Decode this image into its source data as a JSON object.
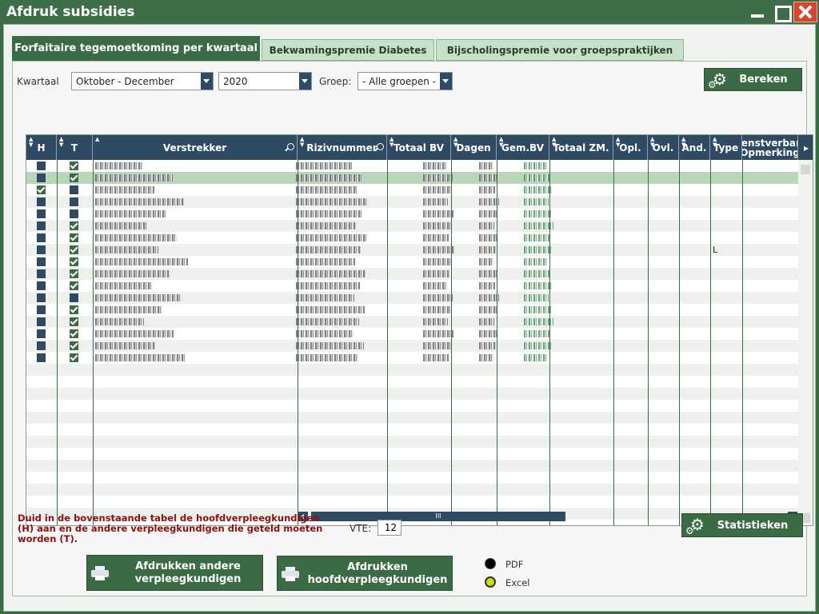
{
  "window": {
    "title": "Afdruk subsidies"
  },
  "tabs": [
    {
      "label": "Forfaitaire tegemoetkoming per kwartaal",
      "active": true
    },
    {
      "label": "Bekwamingspremie Diabetes",
      "active": false
    },
    {
      "label": "Bijscholingspremie voor groepspraktijken",
      "active": false
    }
  ],
  "filters": {
    "kwartaal_label": "Kwartaal",
    "kwartaal_value": "Oktober - December",
    "jaar_value": "2020",
    "groep_label": "Groep:",
    "groep_value": "- Alle groepen -"
  },
  "buttons": {
    "bereken": "Bereken",
    "statistieken": "Statistieken",
    "print_andere": "Afdrukken andere verpleegkundigen",
    "print_hoofd": "Afdrukken hoofdverpleegkundigen"
  },
  "table": {
    "columns": [
      "H",
      "T",
      "Verstrekker",
      "Rizivnummer",
      "Totaal BV",
      "Dagen",
      "Gem.BV",
      "Totaal ZM.",
      "Opl.",
      "Ovl.",
      "And.",
      "Type",
      "Dienstverband Opmerking"
    ],
    "rows": [
      {
        "h": false,
        "t": true,
        "type": ""
      },
      {
        "h": false,
        "t": true,
        "type": ""
      },
      {
        "h": true,
        "t": false,
        "type": ""
      },
      {
        "h": false,
        "t": false,
        "type": ""
      },
      {
        "h": false,
        "t": false,
        "type": ""
      },
      {
        "h": false,
        "t": true,
        "type": ""
      },
      {
        "h": false,
        "t": true,
        "type": ""
      },
      {
        "h": false,
        "t": true,
        "type": "L"
      },
      {
        "h": false,
        "t": true,
        "type": ""
      },
      {
        "h": false,
        "t": true,
        "type": ""
      },
      {
        "h": false,
        "t": true,
        "type": ""
      },
      {
        "h": false,
        "t": false,
        "type": ""
      },
      {
        "h": false,
        "t": true,
        "type": ""
      },
      {
        "h": false,
        "t": true,
        "type": ""
      },
      {
        "h": false,
        "t": true,
        "type": ""
      },
      {
        "h": false,
        "t": true,
        "type": ""
      },
      {
        "h": false,
        "t": true,
        "type": ""
      }
    ],
    "scroll_grip": "III"
  },
  "note": "Duid in de bovenstaande tabel de hoofdverpleegkundigen (H) aan en de andere verpleegkundigen die geteld moeten worden (T).",
  "vte": {
    "label": "VTE:",
    "value": "12"
  },
  "export": {
    "pdf_label": "PDF",
    "excel_label": "Excel",
    "selected": "Excel"
  },
  "colors": {
    "accent": "#3b6b45",
    "header": "#2f4a63",
    "note": "#8b1010",
    "selected_row": "#b9d6bb"
  }
}
